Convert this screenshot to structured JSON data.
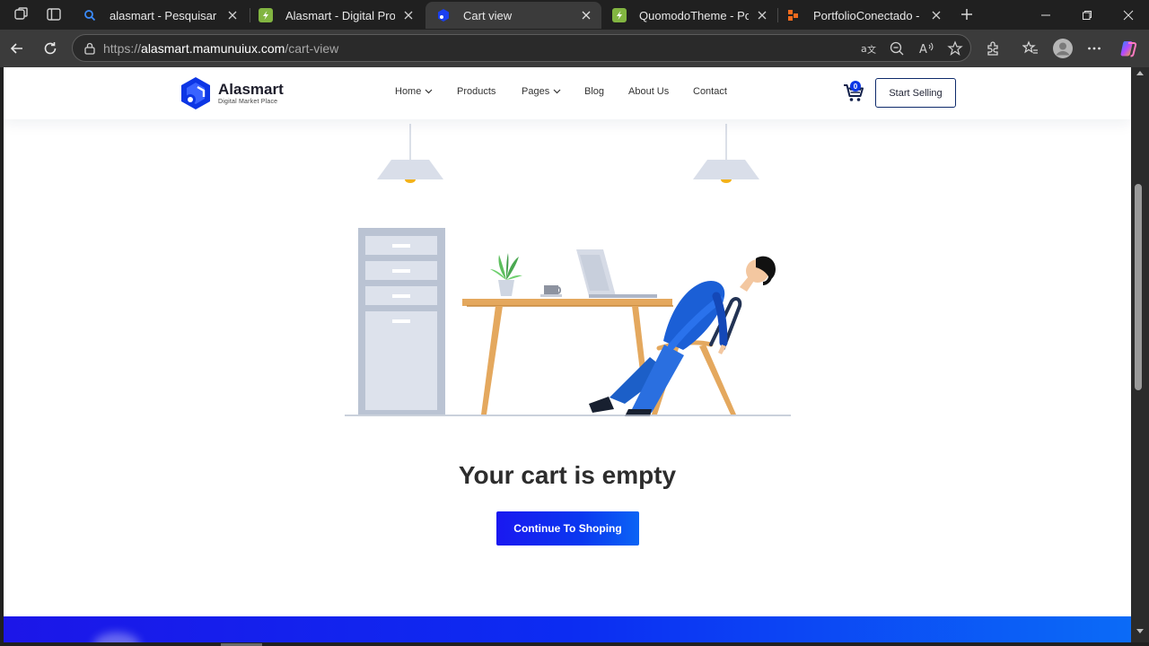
{
  "browser": {
    "tabs": [
      {
        "title": "alasmart - Pesquisar",
        "favicon": "search-icon",
        "active": false
      },
      {
        "title": "Alasmart - Digital Product",
        "favicon": "envato-leaf-icon",
        "active": false
      },
      {
        "title": "Cart view",
        "favicon": "alasmart-logo-icon",
        "active": true
      },
      {
        "title": "QuomodoTheme - Portfolio",
        "favicon": "envato-leaf-icon",
        "active": false
      },
      {
        "title": "PortfolioConectado - Rep",
        "favicon": "orange-dots-icon",
        "active": false
      }
    ],
    "address_bar": {
      "prefix": "https://",
      "host": "alasmart.mamunuiux.com",
      "path": "/cart-view"
    }
  },
  "site": {
    "brand": {
      "name": "Alasmart",
      "tagline": "Digital Market Place",
      "color": "#0d36e5"
    },
    "nav": [
      {
        "label": "Home",
        "dropdown": true
      },
      {
        "label": "Products",
        "dropdown": false
      },
      {
        "label": "Pages",
        "dropdown": true
      },
      {
        "label": "Blog",
        "dropdown": false
      },
      {
        "label": "About Us",
        "dropdown": false
      },
      {
        "label": "Contact",
        "dropdown": false
      }
    ],
    "cart_count": "0",
    "cta_label": "Start Selling"
  },
  "main": {
    "empty_title": "Your cart is empty",
    "continue_label": "Continue To Shoping"
  },
  "colors": {
    "primary": "#0d36e5",
    "footer_gradient_start": "#1c16e8",
    "footer_gradient_end": "#0b6bf7"
  }
}
